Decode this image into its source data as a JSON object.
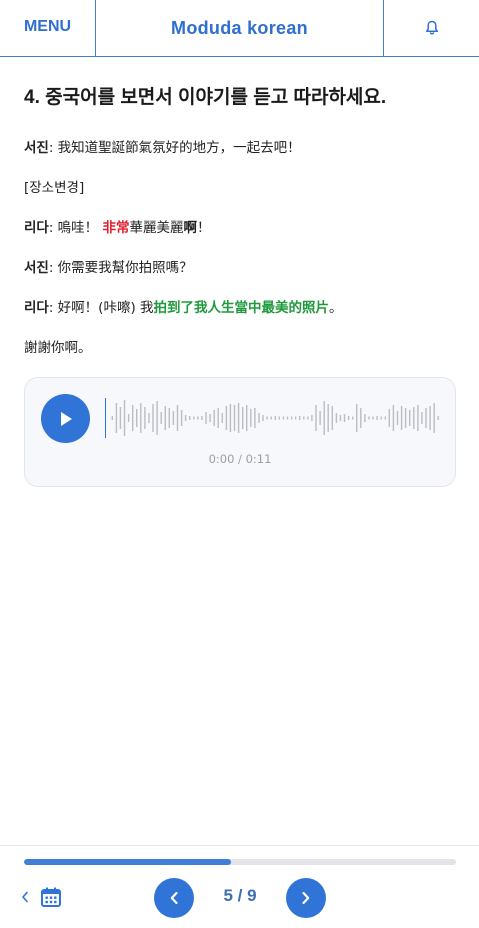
{
  "header": {
    "menu_label": "MENU",
    "logo_text": "Moduda korean",
    "bell_icon": "bell-icon"
  },
  "exercise": {
    "title": "4. 중국어를 보면서 이야기를 듣고 따라하세요.",
    "lines": [
      {
        "speaker": "서진",
        "parts": [
          {
            "text": ": 我知道聖誕節氣氛好的地方，一起去吧！",
            "style": "normal"
          }
        ]
      },
      {
        "speaker": "",
        "parts": [
          {
            "text": "[장소변경]",
            "style": "normal"
          }
        ]
      },
      {
        "speaker": "리다",
        "parts": [
          {
            "text": ": 嗚哇！ ",
            "style": "normal"
          },
          {
            "text": "非常",
            "style": "red"
          },
          {
            "text": "華麗美麗",
            "style": "normal"
          },
          {
            "text": "啊",
            "style": "bold"
          },
          {
            "text": "！",
            "style": "normal"
          }
        ]
      },
      {
        "speaker": "서진",
        "parts": [
          {
            "text": ": 你需要我幫你拍照嗎？",
            "style": "normal"
          }
        ]
      },
      {
        "speaker": "리다",
        "parts": [
          {
            "text": ": 好啊！(咔嚓) 我",
            "style": "normal"
          },
          {
            "text": "拍到了我人生當中最美的照片",
            "style": "green"
          },
          {
            "text": "。",
            "style": "normal"
          }
        ]
      },
      {
        "speaker": "",
        "parts": [
          {
            "text": "謝謝你啊。",
            "style": "normal"
          }
        ]
      }
    ]
  },
  "audio": {
    "time_display": "0:00 / 0:11",
    "play_icon": "play-icon",
    "progress": 0
  },
  "footer": {
    "page_label": "5 / 9",
    "progress_fraction": 0.48,
    "icons": [
      "chevron-left-icon",
      "calendar-icon",
      "prev-arrow-icon",
      "next-arrow-icon"
    ]
  },
  "colors": {
    "brand": "#2f74d6",
    "highlight_red": "#e0202f",
    "highlight_green": "#1e9a3d"
  }
}
